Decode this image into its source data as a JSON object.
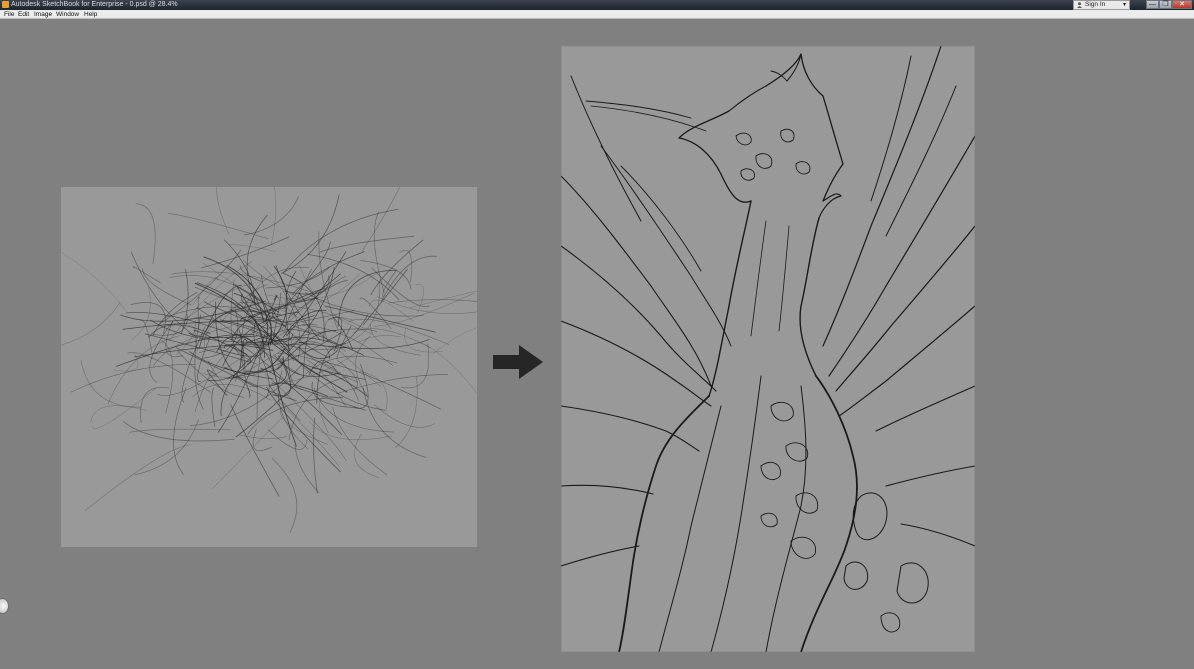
{
  "window": {
    "title": "Autodesk SketchBook for Enterprise - 0.psd @ 28.4%",
    "sign_in_label": "Sign In",
    "controls": [
      "—",
      "❐",
      "✕"
    ]
  },
  "menu": [
    "File",
    "Edit",
    "Image",
    "Window",
    "Help"
  ],
  "icons": {
    "app": "sketchbook-app-icon",
    "person": "person-icon",
    "dropdown": "chevron-down-icon",
    "arrow": "right-arrow-icon",
    "dial": "rotation-dial-icon"
  },
  "colors": {
    "workspace": "#808080",
    "canvas": "#999999",
    "ink": "#1a1a1a"
  }
}
